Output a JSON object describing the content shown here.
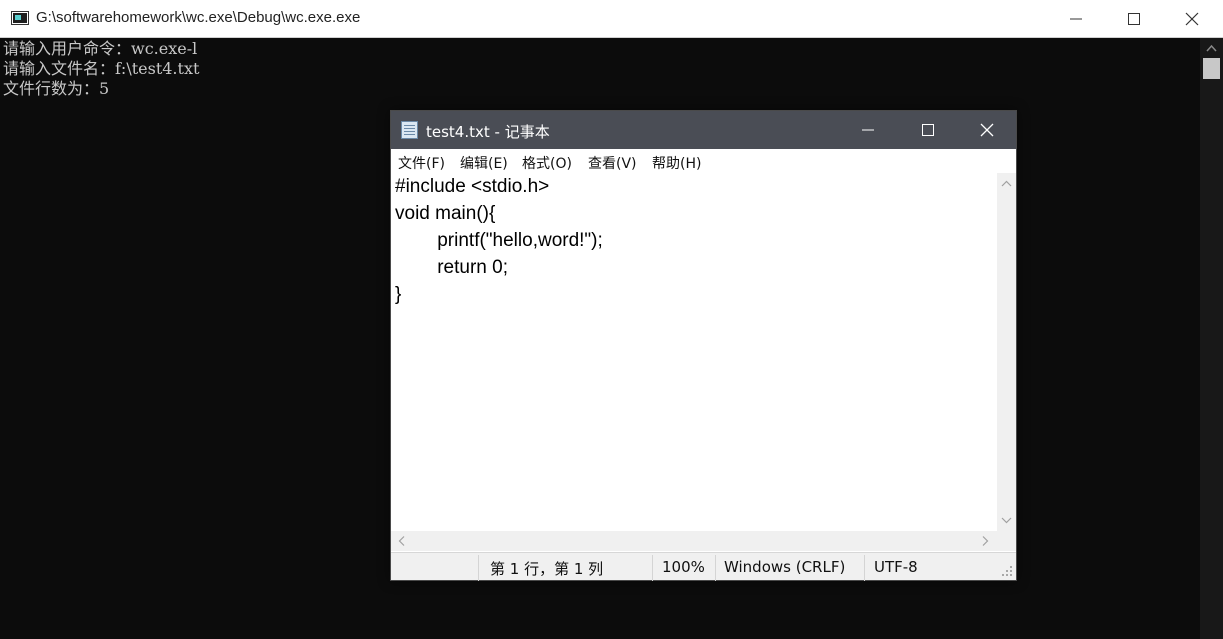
{
  "console": {
    "title": "G:\\softwarehomework\\wc.exe\\Debug\\wc.exe.exe",
    "lines": [
      "请输入用户命令：wc.exe-l",
      "请输入文件名：f:\\test4.txt",
      "文件行数为：5"
    ]
  },
  "notepad": {
    "title": "test4.txt - 记事本",
    "menu": [
      "文件(F)",
      "编辑(E)",
      "格式(O)",
      "查看(V)",
      "帮助(H)"
    ],
    "content": [
      "#include <stdio.h>",
      "void main(){",
      "\t\tprintf(\"hello,word!\");",
      "\t\treturn 0;",
      "}"
    ],
    "status": {
      "position": "第 1 行，第 1 列",
      "zoom": "100%",
      "line_ending": "Windows (CRLF)",
      "encoding": "UTF-8"
    }
  },
  "icons": {
    "console_app": "console-app-icon",
    "notepad_app": "notepad-app-icon",
    "minimize": "minimize-icon",
    "maximize": "maximize-icon",
    "close": "close-icon"
  },
  "colors": {
    "console_bg": "#0c0c0c",
    "console_text": "#c8c8c8",
    "notepad_titlebar": "#4a4d55"
  }
}
